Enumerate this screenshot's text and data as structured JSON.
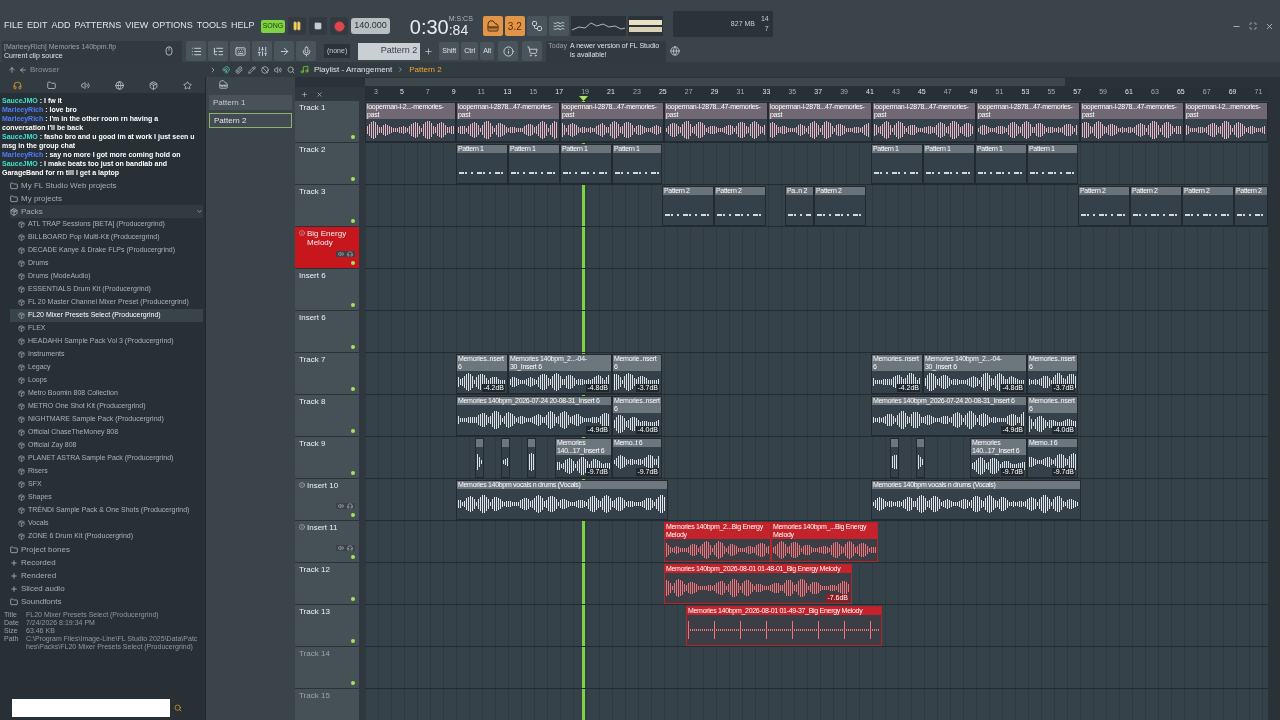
{
  "menu": [
    "FILE",
    "EDIT",
    "ADD",
    "PATTERNS",
    "VIEW",
    "OPTIONS",
    "TOOLS",
    "HELP"
  ],
  "transport": {
    "mode": {
      "label": "SONG",
      "selected": true
    },
    "playing": true,
    "tempo": "140.000",
    "time": "0:30",
    "time_fraction": ":84",
    "time_unit": "M:S:CS",
    "toggle_text": "3.2"
  },
  "monitor": {
    "cpu": "14",
    "memory": "827 MB",
    "polyphony": "7"
  },
  "hint": {
    "title": "[MarleeyRich] Memories 140bpm.flp",
    "text": "Current clip source"
  },
  "pattern_selector": {
    "channel": "(none)",
    "pattern": "Pattern 2"
  },
  "modifier_keys": [
    "Shift",
    "Ctrl",
    "Alt"
  ],
  "news": {
    "date": "Today",
    "text": "A newer version of FL Studio is available!"
  },
  "browser": {
    "title": "Browser",
    "chat": [
      {
        "user": "SauceJMO",
        "color": "#3fe0cf",
        "message": ": I fw it"
      },
      {
        "user": "MarleeyRich",
        "color": "#4f7dff",
        "message": ": love bro"
      },
      {
        "user": "MarleeyRich",
        "color": "#4f7dff",
        "message": ": I'm in the other room rn having a conversation I'll be back"
      },
      {
        "user": "SauceJMO",
        "color": "#3fe0cf",
        "message": ": fasho bro and u good im at work I just seen u msg in the group chat"
      },
      {
        "user": "MarleeyRich",
        "color": "#4f7dff",
        "message": ": say no more I got more coming hold on"
      },
      {
        "user": "SauceJMO",
        "color": "#3fe0cf",
        "message": ": I make beats too just on bandlab and GarageBand for rn till I get a laptop"
      }
    ],
    "folders": [
      {
        "label": "My FL Studio Web projects",
        "kind": "folder",
        "expanded": false
      },
      {
        "label": "My projects",
        "kind": "folder",
        "expanded": false
      },
      {
        "label": "Packs",
        "kind": "pack",
        "expanded": true,
        "children": [
          {
            "label": "ATL TRAP Sessions [BETA] (Producergrind)",
            "selected": false
          },
          {
            "label": "BILLBOARD Pop Multi-Kit (Producergrind)",
            "selected": false
          },
          {
            "label": "DECADE Kanye & Drake FLPs (Producergrind)",
            "selected": false
          },
          {
            "label": "Drums",
            "selected": false
          },
          {
            "label": "Drums (ModeAudio)",
            "selected": false
          },
          {
            "label": "ESSENTIALS Drum Kit (Producergrind)",
            "selected": false
          },
          {
            "label": "FL 20 Master Channel Mixer Preset (Producergrind)",
            "selected": false
          },
          {
            "label": "FL20 Mixer Presets Select (Producergrind)",
            "selected": true
          },
          {
            "label": "FLEX",
            "selected": false
          },
          {
            "label": "HEADAHH Sample Pack Vol 3 (Producergrind)",
            "selected": false
          },
          {
            "label": "Instruments",
            "selected": false
          },
          {
            "label": "Legacy",
            "selected": false
          },
          {
            "label": "Loops",
            "selected": false
          },
          {
            "label": "Metro Boomin 808 Collection",
            "selected": false
          },
          {
            "label": "METRO One Shot Kit (Producergrind)",
            "selected": false
          },
          {
            "label": "NIGHTMARE Sample Pack (Producergrind)",
            "selected": false
          },
          {
            "label": "Official ChaseTheMoney 808",
            "selected": false
          },
          {
            "label": "Official Zay 808",
            "selected": false
          },
          {
            "label": "PLANET ASTRA Sample Pack (Producergrind)",
            "selected": false
          },
          {
            "label": "Risers",
            "selected": false
          },
          {
            "label": "SFX",
            "selected": false
          },
          {
            "label": "Shapes",
            "selected": false
          },
          {
            "label": "TRÉNDI Sample Pack & One Shots (Producergrind)",
            "selected": false
          },
          {
            "label": "Vocals",
            "selected": false
          },
          {
            "label": "ZONE 6 Drum Kit (Producergrind)",
            "selected": false
          }
        ]
      },
      {
        "label": "Project bones",
        "kind": "folder",
        "expanded": false
      },
      {
        "label": "Recorded",
        "kind": "capture",
        "expanded": false
      },
      {
        "label": "Rendered",
        "kind": "render",
        "expanded": false
      },
      {
        "label": "Sliced audio",
        "kind": "capture",
        "expanded": false
      },
      {
        "label": "Soundfonts",
        "kind": "folder",
        "expanded": false
      }
    ],
    "info": [
      {
        "label": "Title",
        "value": "FL20 Mixer Presets Select (Producergrind)"
      },
      {
        "label": "Date",
        "value": "7/24/2026 8:19:34 PM"
      },
      {
        "label": "Size",
        "value": "63.46 KB"
      },
      {
        "label": "Path",
        "value": "C:\\Program Files\\Image-Line\\FL Studio 2025\\Data\\Patches\\Packs\\FL20 Mixer Presets Select (Producergrind)"
      }
    ]
  },
  "patterns": [
    {
      "label": "Pattern 1",
      "selected": false
    },
    {
      "label": "Pattern 2",
      "selected": true
    }
  ],
  "playlist": {
    "title": "Playlist - Arrangement",
    "pattern": "Pattern 2",
    "ruler": [
      "3",
      "5",
      "7",
      "9",
      "11",
      "13",
      "15",
      "17",
      "19",
      "21",
      "23",
      "25",
      "27",
      "29",
      "31",
      "33",
      "35",
      "37",
      "39",
      "41",
      "43",
      "45",
      "47",
      "49",
      "51",
      "53",
      "55",
      "57",
      "59",
      "61",
      "63",
      "65",
      "67",
      "69",
      "71"
    ],
    "tracks": [
      {
        "name": "Track 1",
        "kind": "track",
        "selected": false,
        "dimmed": false,
        "clips": [
          {
            "kind": "audio",
            "label": "looperman-l-2...-memories-past",
            "color": "#e8b6c2",
            "selected": false
          },
          {
            "kind": "audio",
            "label": "looperman-l-2878...47-memories-past",
            "color": "#e8b6c2",
            "selected": false
          },
          {
            "kind": "audio",
            "label": "looperman-l-2878...47-memories-past",
            "color": "#e8b6c2",
            "selected": false
          },
          {
            "kind": "audio",
            "label": "looperman-l-2878...47-memories-past",
            "color": "#e8b6c2",
            "selected": false
          },
          {
            "kind": "audio",
            "label": "looperman-l-2878...47-memories-past",
            "color": "#e8b6c2",
            "selected": false
          },
          {
            "kind": "audio",
            "label": "looperman-l-2878...47-memories-past",
            "color": "#e8b6c2",
            "selected": false
          },
          {
            "kind": "audio",
            "label": "looperman-l-2878...47-memories-past",
            "color": "#e8b6c2",
            "selected": false
          },
          {
            "kind": "audio",
            "label": "looperman-l-2878...47-memories-past",
            "color": "#e8b6c2",
            "selected": false
          },
          {
            "kind": "audio",
            "label": "looperman-l-2...memories-past",
            "color": "#e8b6c2",
            "selected": false
          }
        ]
      },
      {
        "name": "Track 2",
        "kind": "track",
        "selected": false,
        "dimmed": false,
        "clips": [
          {
            "kind": "pattern",
            "label": "Pattern 1",
            "color": "#d4d9dc",
            "selected": false
          },
          {
            "kind": "pattern",
            "label": "Pattern 1",
            "color": "#d4d9dc",
            "selected": false
          },
          {
            "kind": "pattern",
            "label": "Pattern 1",
            "color": "#d4d9dc",
            "selected": false
          },
          {
            "kind": "pattern",
            "label": "Pattern 1",
            "color": "#d4d9dc",
            "selected": false
          },
          {
            "kind": "pattern",
            "label": "Pattern 1",
            "color": "#d4d9dc",
            "selected": false
          },
          {
            "kind": "pattern",
            "label": "Pattern 1",
            "color": "#d4d9dc",
            "selected": false
          },
          {
            "kind": "pattern",
            "label": "Pattern 1",
            "color": "#d4d9dc",
            "selected": false
          },
          {
            "kind": "pattern",
            "label": "Pattern 1",
            "color": "#d4d9dc",
            "selected": false
          }
        ]
      },
      {
        "name": "Track 3",
        "kind": "track",
        "selected": false,
        "dimmed": false,
        "clips": [
          {
            "kind": "pattern",
            "label": "Pattern 2",
            "color": "#d4d9dc",
            "selected": false
          },
          {
            "kind": "pattern",
            "label": "Pattern 2",
            "color": "#d4d9dc",
            "selected": false
          },
          {
            "kind": "pattern",
            "label": "Pa..n 2",
            "color": "#d4d9dc",
            "selected": false
          },
          {
            "kind": "pattern",
            "label": "Pattern 2",
            "color": "#d4d9dc",
            "selected": false
          },
          {
            "kind": "pattern",
            "label": "Pattern 2",
            "color": "#d4d9dc",
            "selected": false
          },
          {
            "kind": "pattern",
            "label": "Pattern 2",
            "color": "#d4d9dc",
            "selected": false
          },
          {
            "kind": "pattern",
            "label": "Pattern 2",
            "color": "#d4d9dc",
            "selected": false
          },
          {
            "kind": "pattern",
            "label": "Pattern 2",
            "color": "#d4d9dc",
            "selected": false
          }
        ]
      },
      {
        "name": "Big Energy Melody",
        "kind": "insert",
        "selected": true,
        "dimmed": false
      },
      {
        "name": "Insert 6",
        "kind": "track",
        "selected": false,
        "dimmed": false
      },
      {
        "name": "Insert 6",
        "kind": "track",
        "selected": false,
        "dimmed": false
      },
      {
        "name": "Track 7",
        "kind": "track",
        "selected": false,
        "dimmed": false,
        "clips": [
          {
            "kind": "audio",
            "label": "Memories..nsert 6",
            "color": "#dce1e4",
            "selected": false,
            "gain": "-4.2dB"
          },
          {
            "kind": "audio",
            "label": "Memories 140bpm_2...-04-30_Insert 6",
            "color": "#dce1e4",
            "selected": false,
            "gain": "-4.8dB"
          },
          {
            "kind": "audio",
            "label": "Memorie..nsert 6",
            "color": "#dce1e4",
            "selected": false,
            "gain": "-3.7dB"
          },
          {
            "kind": "audio",
            "label": "Memories..nsert 6",
            "color": "#dce1e4",
            "selected": false,
            "gain": "-4.2dB"
          },
          {
            "kind": "audio",
            "label": "Memories 140bpm_2...-04-30_Insert 6",
            "color": "#dce1e4",
            "selected": false,
            "gain": "-4.8dB"
          },
          {
            "kind": "audio",
            "label": "Memories..nsert 6",
            "color": "#dce1e4",
            "selected": false,
            "gain": "-3.7dB"
          }
        ]
      },
      {
        "name": "Track 8",
        "kind": "track",
        "selected": false,
        "dimmed": false,
        "clips": [
          {
            "kind": "audio",
            "label": "Memories 140bpm_2026-07-24 20-08-31_Insert 6",
            "color": "#dce1e4",
            "selected": false,
            "gain": "-4.9dB"
          },
          {
            "kind": "audio",
            "label": "Memories..nsert 6",
            "color": "#dce1e4",
            "selected": false,
            "gain": "-4.0dB"
          },
          {
            "kind": "audio",
            "label": "Memories 140bpm_2026-07-24 20-08-31_Insert 6",
            "color": "#dce1e4",
            "selected": false,
            "gain": "-4.9dB"
          },
          {
            "kind": "audio",
            "label": "Memories..nsert 6",
            "color": "#dce1e4",
            "selected": false,
            "gain": "-4.0dB"
          }
        ]
      },
      {
        "name": "Track 9",
        "kind": "track",
        "selected": false,
        "dimmed": false,
        "clips": [
          {
            "kind": "audio",
            "color": "#dce1e4",
            "selected": false
          },
          {
            "kind": "audio",
            "color": "#dce1e4",
            "selected": false
          },
          {
            "kind": "audio",
            "color": "#dce1e4",
            "selected": false
          },
          {
            "kind": "audio",
            "label": "Memories 140...17_Insert 6",
            "color": "#dce1e4",
            "selected": false,
            "gain": "-9.7dB"
          },
          {
            "kind": "audio",
            "label": "Memo..t 6",
            "color": "#dce1e4",
            "selected": false,
            "gain": "-9.7dB"
          },
          {
            "kind": "audio",
            "color": "#dce1e4",
            "selected": false
          },
          {
            "kind": "audio",
            "color": "#dce1e4",
            "selected": false
          },
          {
            "kind": "audio",
            "label": "Memories 140...17_Insert 6",
            "color": "#dce1e4",
            "selected": false,
            "gain": "-9.7dB"
          },
          {
            "kind": "audio",
            "label": "Memo..t 6",
            "color": "#dce1e4",
            "selected": false,
            "gain": "-9.7dB"
          }
        ]
      },
      {
        "name": "Insert 10",
        "kind": "insert",
        "selected": false,
        "dimmed": false,
        "clips": [
          {
            "kind": "audio",
            "label": "Memories 140bpm vocals n drums (Vocals)",
            "color": "#e4e7ea",
            "selected": false
          },
          {
            "kind": "audio",
            "label": "Memories 140bpm vocals n drums (Vocals)",
            "color": "#e4e7ea",
            "selected": false
          }
        ]
      },
      {
        "name": "Insert 11",
        "kind": "insert",
        "selected": false,
        "dimmed": false,
        "clips": [
          {
            "kind": "audio",
            "label": "Memories 140bpm_2...Big Energy Melody",
            "color": "#f2737a",
            "selected": true
          },
          {
            "kind": "audio",
            "label": "Memories 140bpm_...Big Energy Melody",
            "color": "#f2737a",
            "selected": true
          }
        ]
      },
      {
        "name": "Track 12",
        "kind": "track",
        "selected": false,
        "dimmed": false,
        "clips": [
          {
            "kind": "audio",
            "label": "Memories 140bpm_2026-08-01 01-48-01_Big Energy Melody",
            "color": "#f2737a",
            "selected": true,
            "gain": "-7.6dB"
          }
        ]
      },
      {
        "name": "Track 13",
        "kind": "track",
        "selected": false,
        "dimmed": false,
        "clips": [
          {
            "kind": "spikes",
            "label": "Memories 140bpm_2026-08-01 01-49-37_Big Energy Melody",
            "color": "#f2737a",
            "selected": true
          }
        ]
      },
      {
        "name": "Track 14",
        "kind": "track",
        "selected": false,
        "dimmed": true
      },
      {
        "name": "Track 15",
        "kind": "track",
        "selected": false,
        "dimmed": true
      }
    ]
  }
}
